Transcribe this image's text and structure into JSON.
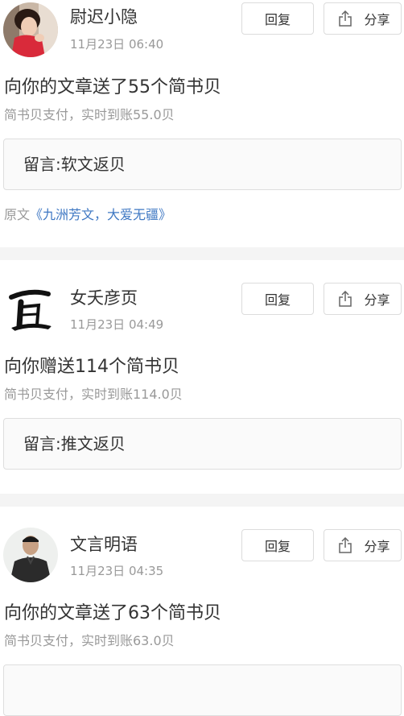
{
  "buttons": {
    "reply_label": "回复",
    "share_label": "分享"
  },
  "colors": {
    "link": "#3f78c3",
    "muted": "#999999",
    "text": "#333333",
    "separator": "#f4f4f4"
  },
  "notifications": [
    {
      "username": "尉迟小隐",
      "time": "11月23日 06:40",
      "headline": "向你的文章送了55个简书贝",
      "subline": "简书贝支付，实时到账55.0贝",
      "message": "留言:软文返贝",
      "source_prefix": "原文",
      "source_title": "《九洲芳文，大爱无疆》"
    },
    {
      "username": "女夭彦页",
      "time": "11月23日 04:49",
      "headline": "向你赠送114个简书贝",
      "subline": "简书贝支付，实时到账114.0贝",
      "message": "留言:推文返贝"
    },
    {
      "username": "文言明语",
      "time": "11月23日 04:35",
      "headline": "向你的文章送了63个简书贝",
      "subline": "简书贝支付，实时到账63.0贝"
    }
  ]
}
